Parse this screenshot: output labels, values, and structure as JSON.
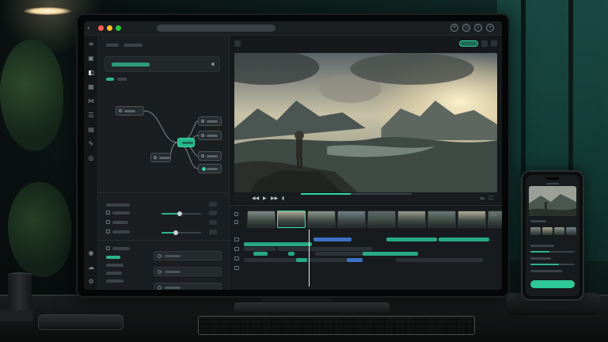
{
  "app": {
    "window_controls": [
      "close",
      "minimize",
      "zoom"
    ],
    "titlebar_right_icons": [
      "plus-circle-icon",
      "globe-icon",
      "info-icon",
      "user-icon"
    ]
  },
  "icon_rail": {
    "items": [
      "menu-icon",
      "camera-icon",
      "layers-icon",
      "grid-icon",
      "nodes-icon",
      "sliders-icon",
      "file-icon",
      "pen-icon",
      "settings-icon"
    ],
    "bottom_items": [
      "user-icon",
      "cloud-icon",
      "gear-icon"
    ],
    "active_index": 1
  },
  "viewer": {
    "playback_progress": 0.45,
    "transport_icons": [
      "skip-back-icon",
      "play-icon",
      "skip-forward-icon",
      "volume-icon"
    ],
    "right_icons": [
      "subtitles-icon",
      "fullscreen-icon"
    ]
  },
  "left_panel": {
    "node_graph": {
      "nodes": [
        "input",
        "process",
        "output-a",
        "output-b",
        "output-c",
        "output-d"
      ],
      "active_node": "process"
    },
    "sliders": [
      0.45,
      0.35
    ]
  },
  "timeline": {
    "thumbnail_count": 9,
    "selected_thumbnail_index": 1,
    "playhead_position": 0.29
  },
  "colors": {
    "accent": "#2fb38a",
    "accent_bright": "#36d39f",
    "clip_blue": "#3d71c2",
    "panel_bg": "#1a1e21",
    "close": "#ff5f57",
    "minimize": "#febc2e",
    "zoom": "#28c840"
  }
}
